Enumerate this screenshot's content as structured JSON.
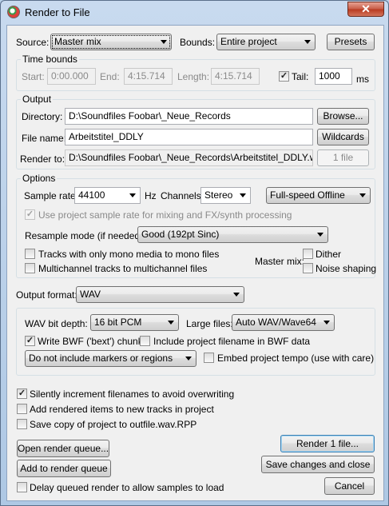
{
  "window": {
    "title": "Render to File",
    "close_glyph": "✕"
  },
  "source": {
    "label": "Source:",
    "value": "Master mix"
  },
  "bounds": {
    "label": "Bounds:",
    "value": "Entire project"
  },
  "presets_label": "Presets",
  "time_bounds": {
    "group_label": "Time bounds",
    "start_label": "Start:",
    "start_value": "0:00.000",
    "end_label": "End:",
    "end_value": "4:15.714",
    "length_label": "Length:",
    "length_value": "4:15.714",
    "tail_label": "Tail:",
    "tail_checked": true,
    "tail_value": "1000",
    "tail_unit": "ms"
  },
  "output": {
    "group_label": "Output",
    "directory_label": "Directory:",
    "directory_value": "D:\\Soundfiles Foobar\\_Neue_Records",
    "browse_label": "Browse...",
    "filename_label": "File name:",
    "filename_value": "Arbeitstitel_DDLY",
    "wildcards_label": "Wildcards",
    "renderto_label": "Render to:",
    "renderto_value": "D:\\Soundfiles Foobar\\_Neue_Records\\Arbeitstitel_DDLY.wav",
    "files_count_label": "1 file"
  },
  "options": {
    "group_label": "Options",
    "samplerate_label": "Sample rate:",
    "samplerate_value": "44100",
    "samplerate_unit": "Hz",
    "channels_label": "Channels:",
    "channels_value": "Stereo",
    "speed_value": "Full-speed Offline",
    "use_project_rate_label": "Use project sample rate for mixing and FX/synth processing",
    "resample_label": "Resample mode (if needed):",
    "resample_value": "Good (192pt Sinc)",
    "mono_label": "Tracks with only mono media to mono files",
    "multichannel_label": "Multichannel tracks to multichannel files",
    "master_mix_label": "Master mix:",
    "dither_label": "Dither",
    "noise_shaping_label": "Noise shaping"
  },
  "format": {
    "label": "Output format:",
    "value": "WAV",
    "bitdepth_label": "WAV bit depth:",
    "bitdepth_value": "16 bit PCM",
    "largefiles_label": "Large files:",
    "largefiles_value": "Auto WAV/Wave64",
    "bwf_label": "Write BWF ('bext') chunk",
    "include_filename_label": "Include project filename in BWF data",
    "markers_value": "Do not include markers or regions",
    "embed_tempo_label": "Embed project tempo (use with care)"
  },
  "misc": {
    "silently_increment_label": "Silently increment filenames to avoid overwriting",
    "add_items_label": "Add rendered items to new tracks in project",
    "save_copy_label": "Save copy of project to outfile.wav.RPP"
  },
  "actions": {
    "open_queue_label": "Open render queue...",
    "render_label": "Render 1 file...",
    "add_queue_label": "Add to render queue",
    "save_close_label": "Save changes and close",
    "delay_label": "Delay queued render to allow samples to load",
    "cancel_label": "Cancel"
  }
}
